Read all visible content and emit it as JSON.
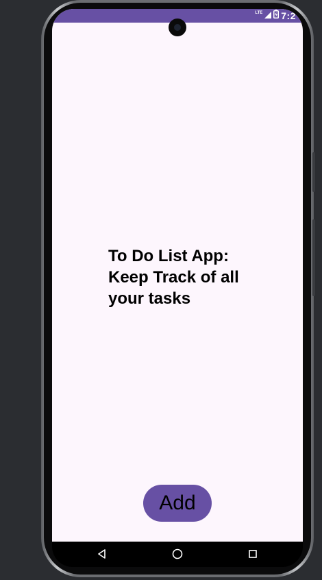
{
  "status_bar": {
    "network_label": "LTE",
    "time": "7:2",
    "bar_color": "#6750a4"
  },
  "main": {
    "title": "To Do List App: Keep Track of all your tasks"
  },
  "add_button": {
    "label": "Add",
    "color": "#6750a4"
  },
  "nav_bar": {
    "items": [
      "back-icon",
      "home-icon",
      "recents-icon"
    ]
  },
  "colors": {
    "screen_background": "#fdf6fd",
    "page_background": "#2b2d31"
  }
}
